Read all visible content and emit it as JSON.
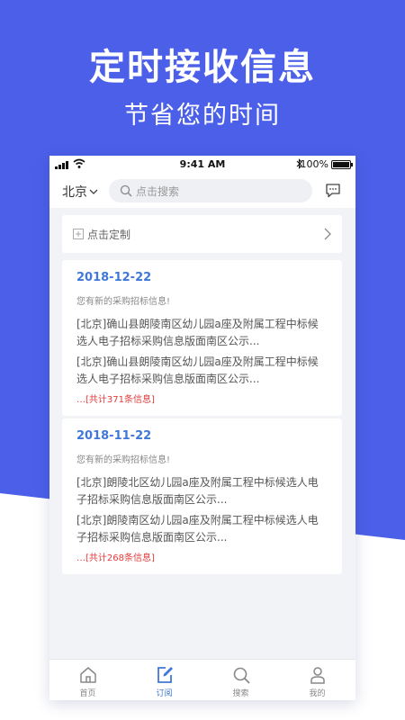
{
  "hero": {
    "title": "定时接收信息",
    "subtitle": "节省您的时间"
  },
  "colors": {
    "hero_blue": "#4b5fe8",
    "accent_blue": "#3f78d8",
    "alert_red": "#e23a3a"
  },
  "status_bar": {
    "time": "9:41 AM",
    "battery": "100%"
  },
  "header": {
    "city": "北京",
    "search_placeholder": "点击搜索",
    "message_icon": "chat-bubble-icon"
  },
  "custom_entry": {
    "label": "点击定制"
  },
  "cards": [
    {
      "date": "2018-12-22",
      "notice": "您有新的采购招标信息!",
      "items": [
        "[北京]确山县朗陵南区幼儿园a座及附属工程中标候选人电子招标采购信息版面南区公示...",
        "[北京]确山县朗陵南区幼儿园a座及附属工程中标候选人电子招标采购信息版面南区公示..."
      ],
      "total": "…[共计371条信息]"
    },
    {
      "date": "2018-11-22",
      "notice": "您有新的采购招标信息!",
      "items": [
        "[北京]朗陵北区幼儿园a座及附属工程中标候选人电子招标采购信息版面南区公示...",
        "[北京]朗陵南区幼儿园a座及附属工程中标候选人电子招标采购信息版面南区公示..."
      ],
      "total": "…[共计268条信息]"
    }
  ],
  "tabs": [
    {
      "label": "首页",
      "icon": "home-icon",
      "active": false
    },
    {
      "label": "订阅",
      "icon": "subscribe-edit-icon",
      "active": true
    },
    {
      "label": "搜索",
      "icon": "search-icon",
      "active": false
    },
    {
      "label": "我的",
      "icon": "profile-icon",
      "active": false
    }
  ]
}
